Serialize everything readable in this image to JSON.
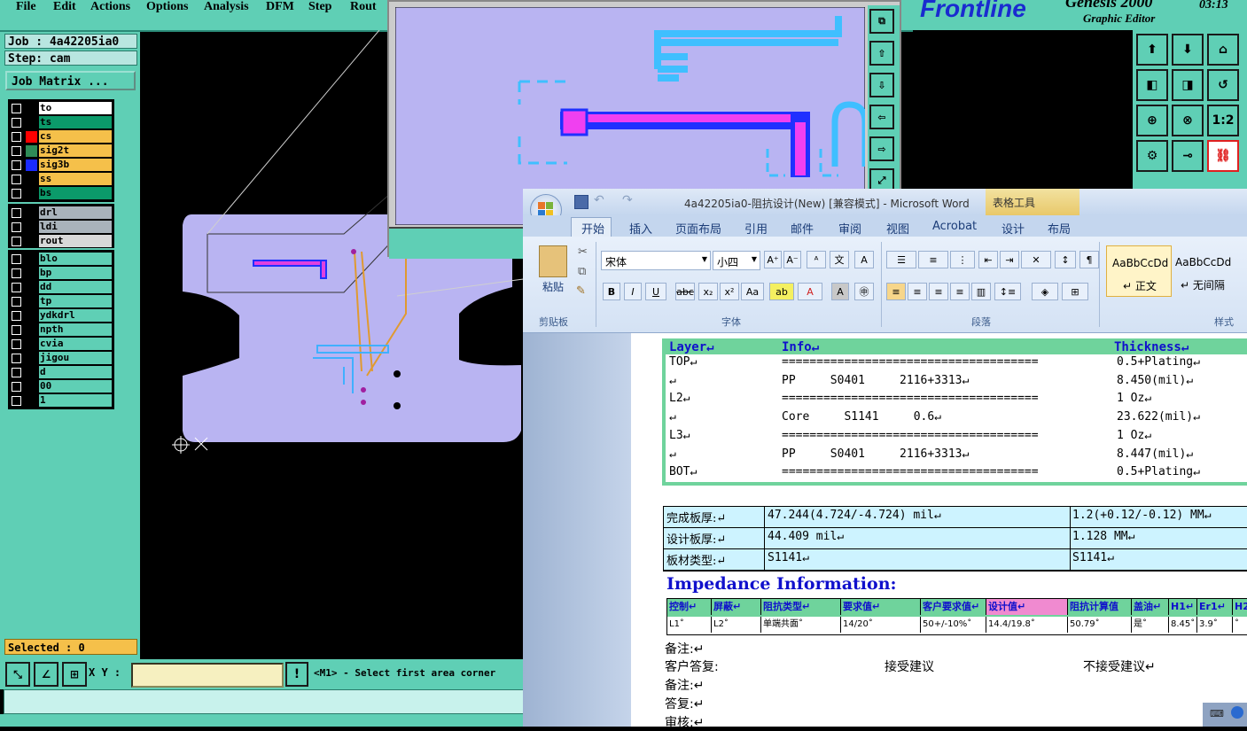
{
  "menu": [
    "File",
    "Edit",
    "Actions",
    "Options",
    "Analysis",
    "DFM",
    "Step",
    "Rout"
  ],
  "logo": {
    "brand": "Frontline",
    "product": "Genesis 2000",
    "subtitle": "Graphic Editor",
    "time": "03:13"
  },
  "job": {
    "job_label": "Job : 4a42205ia0",
    "step_label": "Step: cam",
    "matrix_button": "Job Matrix ..."
  },
  "layers_group1": [
    {
      "name": "to",
      "fill": "#ffffff",
      "color": ""
    },
    {
      "name": "ts",
      "fill": "#0b9a6a",
      "color": ""
    },
    {
      "name": "cs",
      "fill": "#f5c04a",
      "color": "#ff0000"
    },
    {
      "name": "sig2t",
      "fill": "#f5c04a",
      "color": "#2e8b57"
    },
    {
      "name": "sig3b",
      "fill": "#f5c04a",
      "color": "#1a2bff"
    },
    {
      "name": "ss",
      "fill": "#f5c04a",
      "color": ""
    },
    {
      "name": "bs",
      "fill": "#0b9a6a",
      "color": ""
    }
  ],
  "layers_group2": [
    {
      "name": "drl",
      "fill": "#a9b3bb"
    },
    {
      "name": "ldi",
      "fill": "#a9b3bb"
    },
    {
      "name": "rout",
      "fill": "#d8d8d8"
    }
  ],
  "layers_group3": [
    "blo",
    "bp",
    "dd",
    "tp",
    "ydkdrl",
    "npth",
    "cvia",
    "jigou",
    "d",
    "00",
    "1"
  ],
  "status": {
    "selected": "Selected : 0",
    "xy_label": "X Y :",
    "xy_value": "",
    "prompt": "<M1> - Select first area corner"
  },
  "word": {
    "title": "4a42205ia0-阻抗设计(New) [兼容模式] - Microsoft Word",
    "context_tab": "表格工具",
    "tabs": [
      "开始",
      "插入",
      "页面布局",
      "引用",
      "邮件",
      "审阅",
      "视图",
      "Acrobat",
      "设计",
      "布局"
    ],
    "font_name": "宋体",
    "font_size": "小四",
    "paste": "粘贴",
    "clipboard": "剪贴板",
    "font_group": "字体",
    "para_group": "段落",
    "styles_group": "样式",
    "style1": "AaBbCcDd",
    "style1_name": "↵ 正文",
    "style2": "AaBbCcDd",
    "style2_name": "↵ 无间隔"
  },
  "stackup": {
    "headers": [
      "Layer↵",
      "Info↵",
      "Thickness↵"
    ],
    "rows": [
      {
        "layer": "TOP↵",
        "info": "=====================================",
        "thick": "0.5+Plating↵"
      },
      {
        "layer": "↵",
        "info": "PP     S0401     2116+3313↵",
        "thick": "8.450(mil)↵"
      },
      {
        "layer": "L2↵",
        "info": "=====================================",
        "thick": "1 Oz↵"
      },
      {
        "layer": "↵",
        "info": "Core     S1141     0.6↵",
        "thick": "23.622(mil)↵"
      },
      {
        "layer": "L3↵",
        "info": "=====================================",
        "thick": "1 Oz↵"
      },
      {
        "layer": "↵",
        "info": "PP     S0401     2116+3313↵",
        "thick": "8.447(mil)↵"
      },
      {
        "layer": "BOT↵",
        "info": "=====================================",
        "thick": "0.5+Plating↵"
      }
    ]
  },
  "boardinfo": [
    {
      "label": "完成板厚:↵",
      "v1": "47.244(4.724/-4.724) mil↵",
      "v2": "1.2(+0.12/-0.12) MM↵"
    },
    {
      "label": "设计板厚:↵",
      "v1": "44.409 mil↵",
      "v2": "1.128 MM↵"
    },
    {
      "label": "板材类型:↵",
      "v1": "S1141↵",
      "v2": "S1141↵"
    }
  ],
  "impedance": {
    "title": "Impedance Information:",
    "headers": [
      "控制↵",
      "屏蔽↵",
      "阻抗类型↵",
      "要求值↵",
      "客户要求值↵",
      "设计值↵",
      "阻抗计算值",
      "盖油↵",
      "H1↵",
      "Er1↵",
      "H2"
    ],
    "row": [
      "L1˚",
      "L2˚",
      "单端共面˚",
      "14/20˚",
      "50+/-10%˚",
      "14.4/19.8˚",
      "50.79˚",
      "是˚",
      "8.45˚",
      "3.9˚",
      "˚"
    ]
  },
  "notes": {
    "n1": "备注:↵",
    "n2": "客户答复:",
    "accept": "接受建议",
    "reject": "不接受建议↵",
    "n3": "备注:↵",
    "n4": "答复:↵",
    "n5": "审核:↵"
  }
}
